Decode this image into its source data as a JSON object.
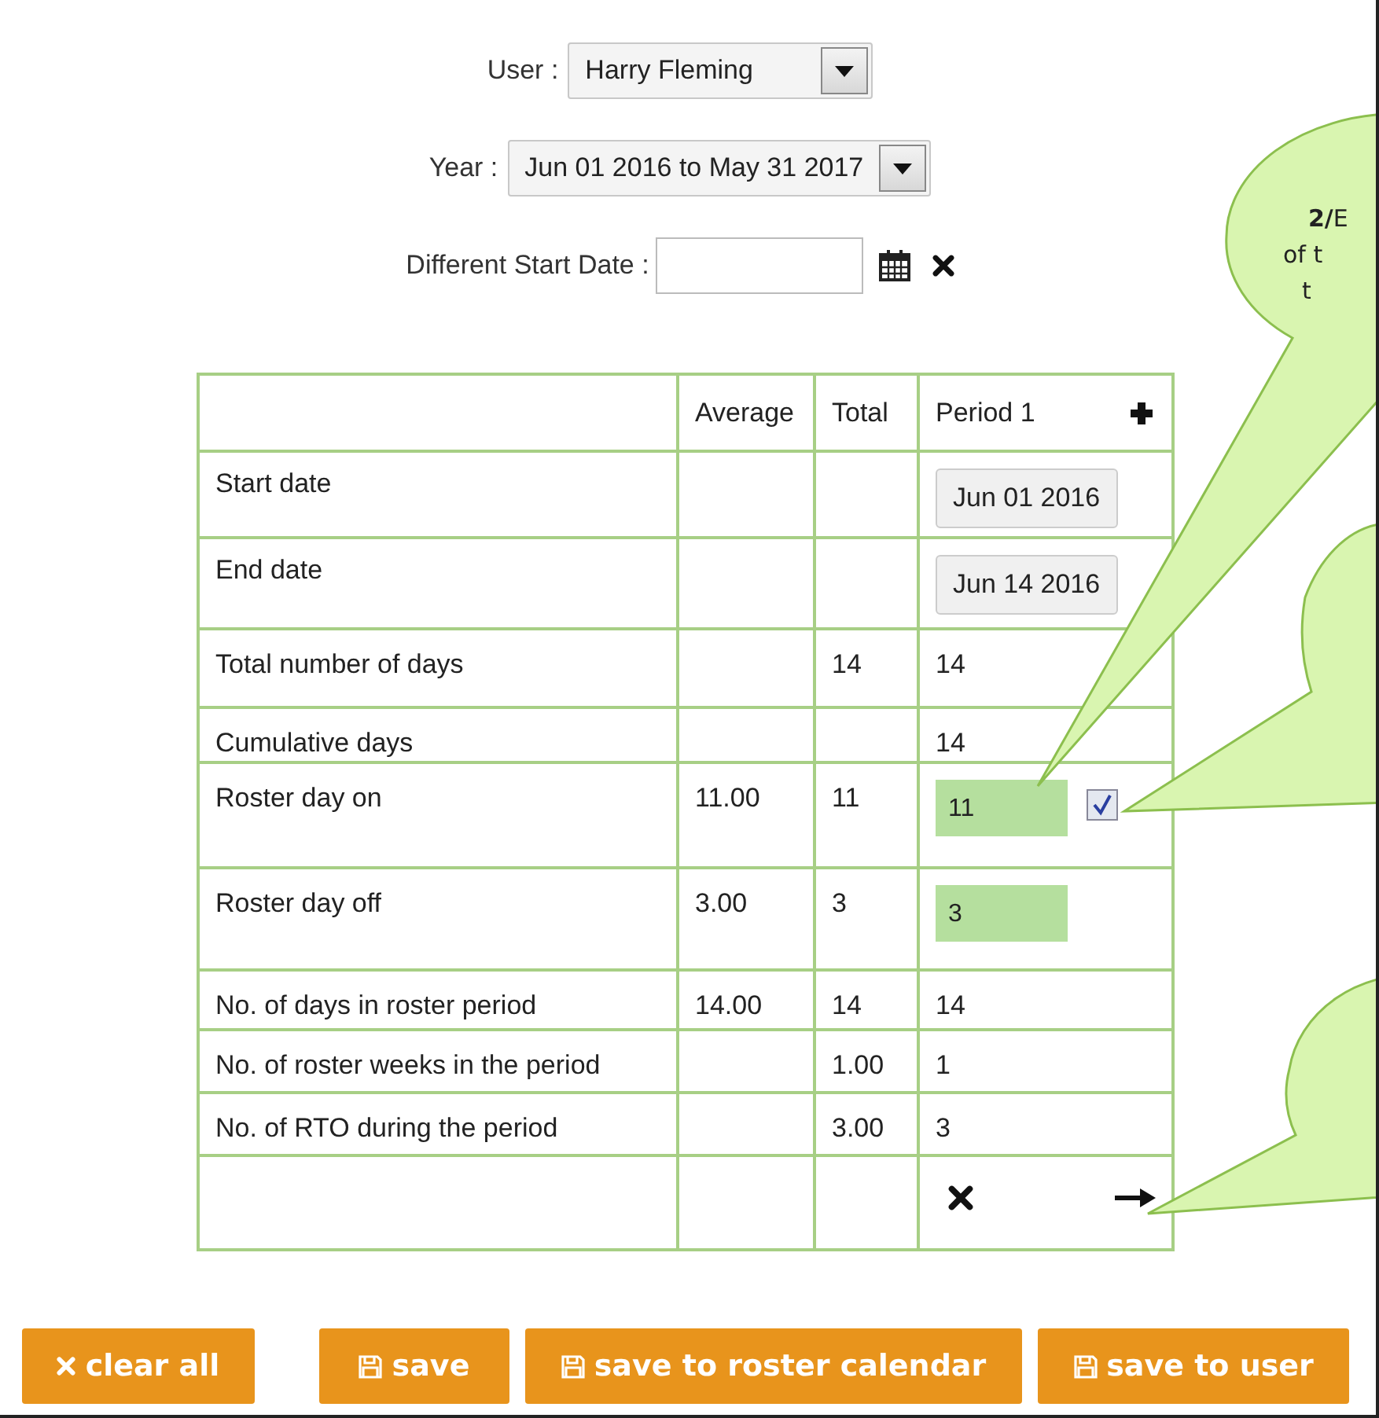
{
  "filters": {
    "user": {
      "label": "User :",
      "value": "Harry Fleming"
    },
    "year": {
      "label": "Year :",
      "value": "Jun 01 2016 to May 31 2017"
    },
    "start_date": {
      "label": "Different Start Date :"
    }
  },
  "table": {
    "columns": [
      "",
      "Average",
      "Total",
      "Period 1"
    ],
    "rows": [
      {
        "kind": "date",
        "label": "Start date",
        "average": "",
        "total": "",
        "value": "Jun 01 2016"
      },
      {
        "kind": "date",
        "label": "End date",
        "average": "",
        "total": "",
        "value": "Jun 14 2016"
      },
      {
        "kind": "text",
        "label": "Total number of days",
        "average": "",
        "total": "14",
        "value": "14"
      },
      {
        "kind": "text",
        "label": "Cumulative days",
        "average": "",
        "total": "",
        "value": "14"
      },
      {
        "kind": "entry",
        "label": "Roster day on",
        "average": "11.00",
        "total": "11",
        "value": "11",
        "checked": true
      },
      {
        "kind": "entry",
        "label": "Roster day off",
        "average": "3.00",
        "total": "3",
        "value": "3"
      },
      {
        "kind": "text",
        "label": "No. of days in roster period",
        "average": "14.00",
        "total": "14",
        "value": "14"
      },
      {
        "kind": "text",
        "label": "No. of roster weeks in the period",
        "average": "",
        "total": "1.00",
        "value": "1"
      },
      {
        "kind": "text",
        "label": "No. of RTO during the period",
        "average": "",
        "total": "3.00",
        "value": "3"
      },
      {
        "kind": "actions",
        "label": "",
        "average": "",
        "total": "",
        "value": ""
      }
    ]
  },
  "callouts": [
    {
      "kind": "bubble",
      "lines": [
        "**2/**E",
        "of t",
        "t"
      ]
    },
    {
      "kind": "bubble"
    },
    {
      "kind": "bubble"
    }
  ],
  "buttons": [
    {
      "kind": "clear",
      "label": "clear all"
    },
    {
      "kind": "save",
      "label": "save"
    },
    {
      "kind": "save",
      "label": "save to roster calendar"
    },
    {
      "kind": "save",
      "label": "save to user"
    }
  ]
}
